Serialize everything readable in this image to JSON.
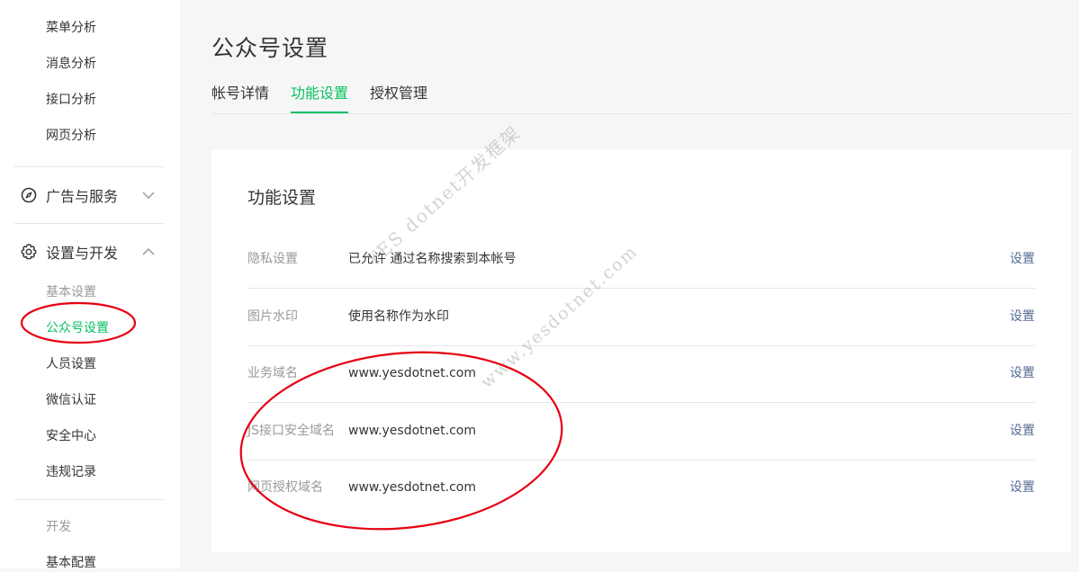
{
  "sidebar": {
    "top_items": [
      {
        "label": "菜单分析"
      },
      {
        "label": "消息分析"
      },
      {
        "label": "接口分析"
      },
      {
        "label": "网页分析"
      }
    ],
    "group_ads": {
      "label": "广告与服务",
      "icon": "compass-icon",
      "expanded": false
    },
    "group_dev": {
      "label": "设置与开发",
      "icon": "gear-icon",
      "expanded": true
    },
    "basic_settings_header": "基本设置",
    "settings_items": [
      {
        "label": "公众号设置",
        "active": true
      },
      {
        "label": "人员设置"
      },
      {
        "label": "微信认证"
      },
      {
        "label": "安全中心"
      },
      {
        "label": "违规记录"
      }
    ],
    "dev_header": "开发",
    "dev_items": [
      {
        "label": "基本配置"
      }
    ]
  },
  "main": {
    "title": "公众号设置",
    "tabs": [
      {
        "label": "帐号详情"
      },
      {
        "label": "功能设置",
        "active": true
      },
      {
        "label": "授权管理"
      }
    ],
    "card": {
      "title": "功能设置",
      "rows": [
        {
          "label": "隐私设置",
          "value": "已允许 通过名称搜索到本帐号",
          "action": "设置"
        },
        {
          "label": "图片水印",
          "value": "使用名称作为水印",
          "action": "设置"
        },
        {
          "label": "业务域名",
          "value": "www.yesdotnet.com",
          "action": "设置"
        },
        {
          "label": "JS接口安全域名",
          "value": "www.yesdotnet.com",
          "action": "设置"
        },
        {
          "label": "网页授权域名",
          "value": "www.yesdotnet.com",
          "action": "设置"
        }
      ]
    }
  },
  "watermark": {
    "line1": "YES dotnet开发框架",
    "line2": "www.yesdotnet.com"
  },
  "colors": {
    "accent": "#07c160",
    "link": "#576b95",
    "annotation": "#e60012"
  }
}
